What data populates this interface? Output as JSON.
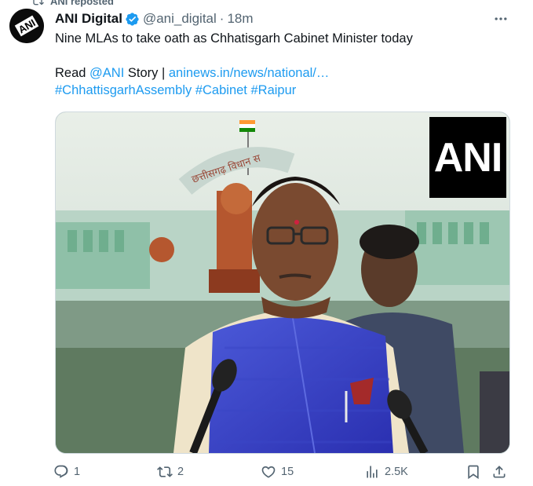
{
  "repost": {
    "label": "ANI reposted"
  },
  "author": {
    "name": "ANI Digital",
    "handle": "@ani_digital",
    "separator": "·",
    "time": "18m",
    "avatar_text": "ANI"
  },
  "tweet": {
    "line1": "Nine MLAs to take oath as Chhatisgarh Cabinet Minister today",
    "read_prefix": "Read ",
    "mention": "@ANI",
    "story_text": " Story | ",
    "url": "aninews.in/news/national/…",
    "hashtags": [
      "#ChhattisgarhAssembly",
      "#Cabinet",
      "#Raipur"
    ]
  },
  "media": {
    "badge": "ANI",
    "building_sign": "छत्तीसगढ़ विधान स"
  },
  "actions": {
    "replies": "1",
    "reposts": "2",
    "likes": "15",
    "views": "2.5K"
  },
  "icons": [
    "repost-icon",
    "verified-icon",
    "more-icon",
    "reply-icon",
    "retweet-icon",
    "like-icon",
    "views-icon",
    "bookmark-icon",
    "share-icon"
  ],
  "colors": {
    "link": "#1d9bf0",
    "muted": "#536471",
    "text": "#0f1419",
    "verified": "#1d9bf0"
  }
}
